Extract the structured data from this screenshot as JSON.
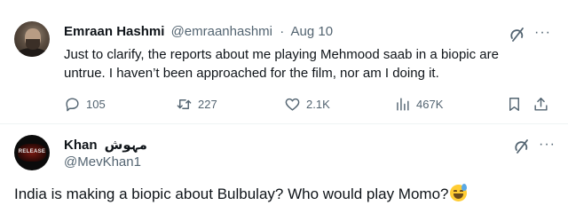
{
  "tweet1": {
    "author_name": "Emraan Hashmi",
    "author_handle": "@emraanhashmi",
    "separator": "·",
    "date": "Aug 10",
    "more_glyph": "···",
    "text": "Just to clarify, the reports about me playing Mehmood saab in a biopic are untrue. I haven’t been approached for the film, nor am I doing it.",
    "stats": {
      "replies": "105",
      "retweets": "227",
      "likes": "2.1K",
      "views": "467K"
    }
  },
  "tweet2": {
    "author_name": "Khan",
    "author_name_urdu": "مہوش",
    "author_handle": "@MevKhan1",
    "more_glyph": "···",
    "avatar_text": "RELEASE",
    "text": "India is making a biopic about Bulbulay? Who would play Momo?"
  },
  "icons": {
    "reply": "reply-icon",
    "retweet": "retweet-icon",
    "like": "heart-icon",
    "views": "views-chart-icon",
    "bookmark": "bookmark-icon",
    "share": "share-icon",
    "grok": "grok-icon",
    "emoji": "grinning-sweat-emoji"
  },
  "colors": {
    "text_primary": "#0f1419",
    "text_secondary": "#536471",
    "divider": "#eff3f4"
  }
}
